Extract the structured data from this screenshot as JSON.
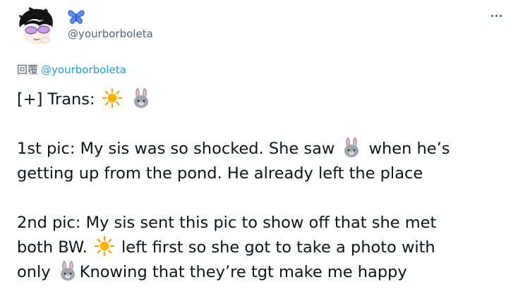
{
  "header": {
    "display_name_icon": "butterfly-icon",
    "handle": "@yourborboleta",
    "more_icon": "ellipsis-icon"
  },
  "reply": {
    "prefix": "回覆",
    "mention": "@yourborboleta"
  },
  "tweet": {
    "line1_text": "[+] Trans:",
    "line2_a": "1st pic: My sis was so shocked. She saw",
    "line2_b": "when he’s",
    "line3": "getting up from the pond. He already left the place",
    "line4": "2nd pic: My sis sent this pic to show off that she met",
    "line5_a": "both BW.",
    "line5_b": "left first so she got to take a photo with",
    "line6_a": "only",
    "line6_b": "Knowing that they’re tgt make me happy"
  },
  "colors": {
    "text": "#0f1419",
    "secondary": "#536471",
    "link": "#1d9bf0"
  }
}
